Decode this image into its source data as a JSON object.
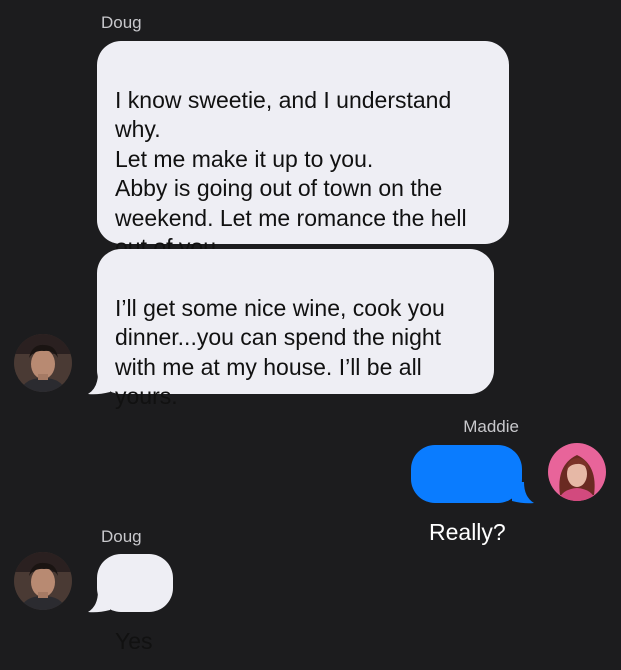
{
  "conversation": {
    "first_group": {
      "sender": "Doug",
      "message_1": "I know sweetie, and I understand why.\nLet me make it up to you.\nAbby is going out of town on the weekend. Let me romance the hell out of you.",
      "message_2": "I’ll get some nice wine, cook you dinner...you can spend the night with me at my house. I’ll be all yours."
    },
    "second_group": {
      "sender": "Maddie",
      "message_1": "Really?"
    },
    "third_group": {
      "sender": "Doug",
      "message_1": "Yes"
    }
  },
  "colors": {
    "background": "#1c1c1e",
    "incoming_bubble": "#eeeef4",
    "outgoing_bubble": "#0a7cff",
    "sender_name": "#c8c8cc"
  }
}
